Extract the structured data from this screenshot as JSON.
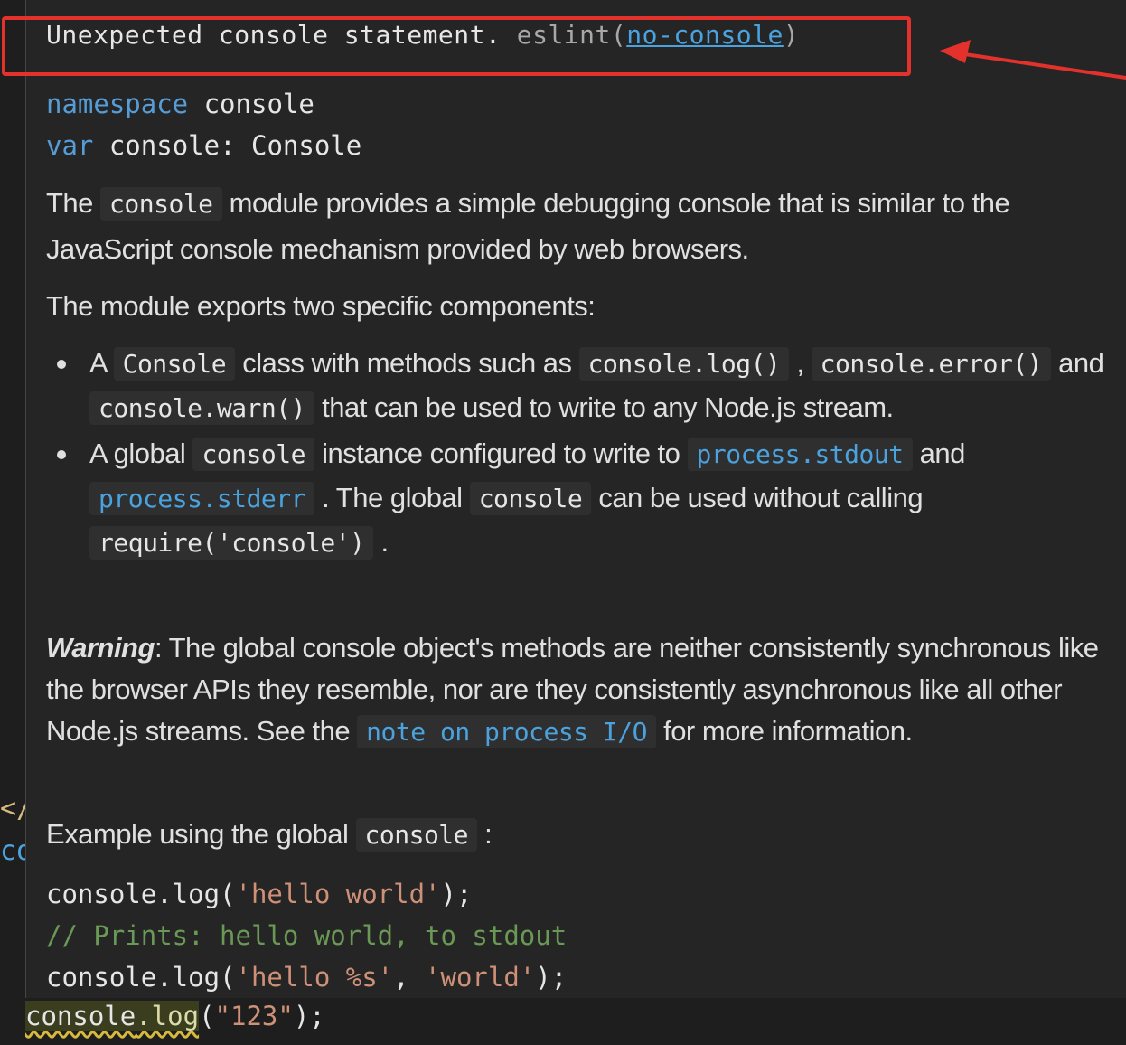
{
  "gutter": {
    "line1": "</",
    "line2": "co"
  },
  "diagnostic": {
    "message": "Unexpected console statement.",
    "source": "eslint(",
    "rule": "no-console",
    "close": ")"
  },
  "signature": {
    "line1_keyword": "namespace",
    "line1_name": " console",
    "line2_keyword": "var",
    "line2_rest": " console: Console"
  },
  "doc": {
    "p1_a": "The ",
    "p1_code": "console",
    "p1_b": " module provides a simple debugging console that is similar to the JavaScript console mechanism provided by web browsers.",
    "p2": "The module exports two specific components:",
    "b1_a": "A ",
    "b1_code1": "Console",
    "b1_b": " class with methods such as ",
    "b1_code2": "console.log()",
    "b1_c": " , ",
    "b1_code3": "console.error()",
    "b1_d": " and ",
    "b1_code4": "console.warn()",
    "b1_e": " that can be used to write to any Node.js stream.",
    "b2_a": "A global ",
    "b2_code1": "console",
    "b2_b": " instance configured to write to ",
    "b2_link1": "process.stdout",
    "b2_c": " and ",
    "b2_link2": "process.stderr",
    "b2_d": " . The global ",
    "b2_code2": "console",
    "b2_e": " can be used without calling ",
    "b2_code3": "require('console')",
    "b2_f": " .",
    "warn_label": "Warning",
    "warn_a": ": The global console object's methods are neither consistently synchronous like the browser APIs they resemble, nor are they consistently asynchronous like all other Node.js streams. See the ",
    "warn_link": "note on process I/O",
    "warn_b": " for more information.",
    "ex_a": "Example using the global ",
    "ex_code": "console",
    "ex_b": " :"
  },
  "code_example": {
    "l1_a": "console.log(",
    "l1_str": "'hello world'",
    "l1_b": ");",
    "l2": "// Prints: hello world, to stdout",
    "l3_a": "console.log(",
    "l3_str1": "'hello %s'",
    "l3_b": ", ",
    "l3_str2": "'world'",
    "l3_c": ");"
  },
  "editor_line": {
    "obj": "console",
    "method": ".log",
    "open": "(",
    "arg": "\"123\"",
    "close": ");"
  },
  "colors": {
    "annotation_red": "#e3322b",
    "link_blue": "#4aa3df",
    "keyword_blue": "#569cd6",
    "string": "#ce9178",
    "comment": "#6a9955",
    "warning_squiggle": "#d7ba3c"
  }
}
